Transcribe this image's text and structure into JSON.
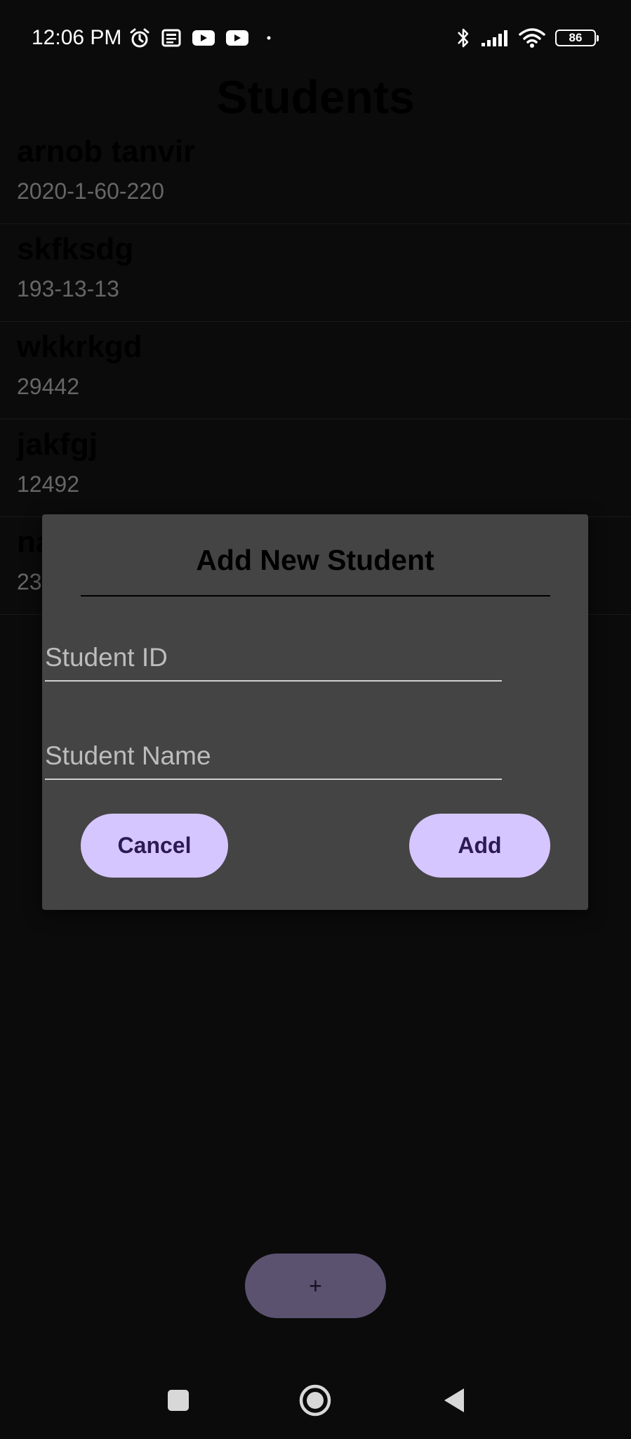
{
  "status_bar": {
    "time": "12:06 PM",
    "battery_level": "86",
    "left_icons": [
      "alarm-icon",
      "news-icon",
      "youtube-icon",
      "youtube-icon",
      "dot-icon"
    ],
    "right_icons": [
      "bluetooth-icon",
      "signal-icon",
      "wifi-icon",
      "battery-icon"
    ]
  },
  "page": {
    "title": "Students"
  },
  "students": [
    {
      "name": "arnob tanvir",
      "id": "2020-1-60-220"
    },
    {
      "name": "skfksdg",
      "id": "193-13-13"
    },
    {
      "name": "wkkrkgd",
      "id": "29442"
    },
    {
      "name": "jakfgj",
      "id": "12492"
    },
    {
      "name": "na",
      "id": "23"
    }
  ],
  "dialog": {
    "title": "Add New Student",
    "student_id_placeholder": "Student ID",
    "student_name_placeholder": "Student Name",
    "cancel_label": "Cancel",
    "add_label": "Add"
  },
  "fab": {
    "label": "+"
  },
  "nav": {
    "items": [
      "recents-icon",
      "home-icon",
      "back-icon"
    ]
  },
  "colors": {
    "background": "#0b0b0b",
    "dialog": "#444444",
    "button": "#d6c6ff",
    "button_text": "#2b1b52",
    "fab": "#5b5270"
  }
}
